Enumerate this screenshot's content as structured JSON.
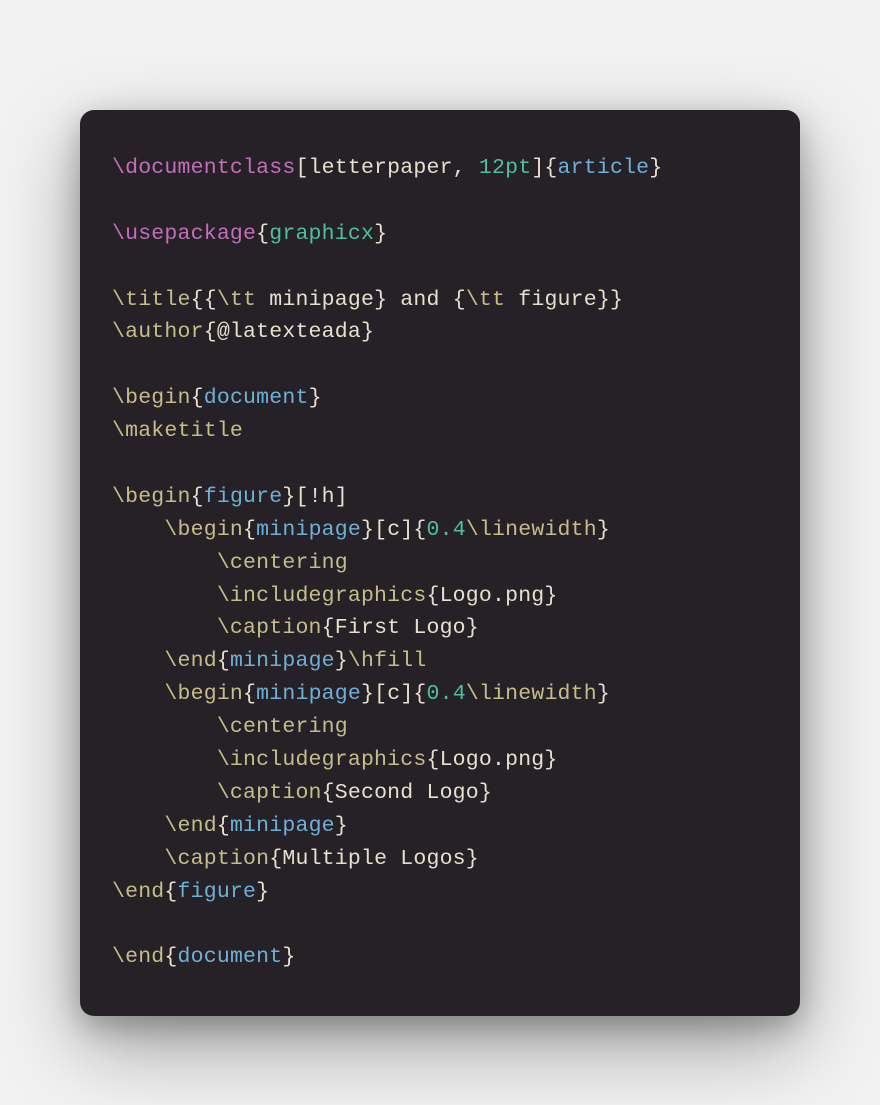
{
  "code": {
    "documentclass": {
      "cmd": "\\documentclass",
      "opt1": "letterpaper",
      "opt_sep": ", ",
      "opt2": "12pt",
      "cls": "article"
    },
    "usepackage": {
      "cmd": "\\usepackage",
      "pkg": "graphicx"
    },
    "title": {
      "cmd": "\\title",
      "open": "{{",
      "tt1": "\\tt",
      "sp1": " ",
      "arg1": "minipage",
      "mid": "} and {",
      "tt2": "\\tt",
      "sp2": " ",
      "arg2": "figure",
      "close": "}}"
    },
    "author": {
      "cmd": "\\author",
      "arg": "@latexteada"
    },
    "begin_doc": {
      "cmd": "\\begin",
      "env": "document"
    },
    "maketitle": {
      "cmd": "\\maketitle"
    },
    "begin_fig": {
      "cmd": "\\begin",
      "env": "figure",
      "opt": "!h"
    },
    "mp1_begin": {
      "indent": "    ",
      "cmd": "\\begin",
      "env": "minipage",
      "opt": "c",
      "pre": "0.4",
      "lw": "\\linewidth"
    },
    "centering1": {
      "indent": "        ",
      "cmd": "\\centering"
    },
    "inc1": {
      "indent": "        ",
      "cmd": "\\includegraphics",
      "arg": "Logo.png"
    },
    "cap1": {
      "indent": "        ",
      "cmd": "\\caption",
      "arg": "First Logo"
    },
    "mp1_end": {
      "indent": "    ",
      "cmd": "\\end",
      "env": "minipage",
      "hfill": "\\hfill"
    },
    "mp2_begin": {
      "indent": "    ",
      "cmd": "\\begin",
      "env": "minipage",
      "opt": "c",
      "pre": "0.4",
      "lw": "\\linewidth"
    },
    "centering2": {
      "indent": "        ",
      "cmd": "\\centering"
    },
    "inc2": {
      "indent": "        ",
      "cmd": "\\includegraphics",
      "arg": "Logo.png"
    },
    "cap2": {
      "indent": "        ",
      "cmd": "\\caption",
      "arg": "Second Logo"
    },
    "mp2_end": {
      "indent": "    ",
      "cmd": "\\end",
      "env": "minipage"
    },
    "cap3": {
      "indent": "    ",
      "cmd": "\\caption",
      "arg": "Multiple Logos"
    },
    "end_fig": {
      "cmd": "\\end",
      "env": "figure"
    },
    "end_doc": {
      "cmd": "\\end",
      "env": "document"
    }
  }
}
